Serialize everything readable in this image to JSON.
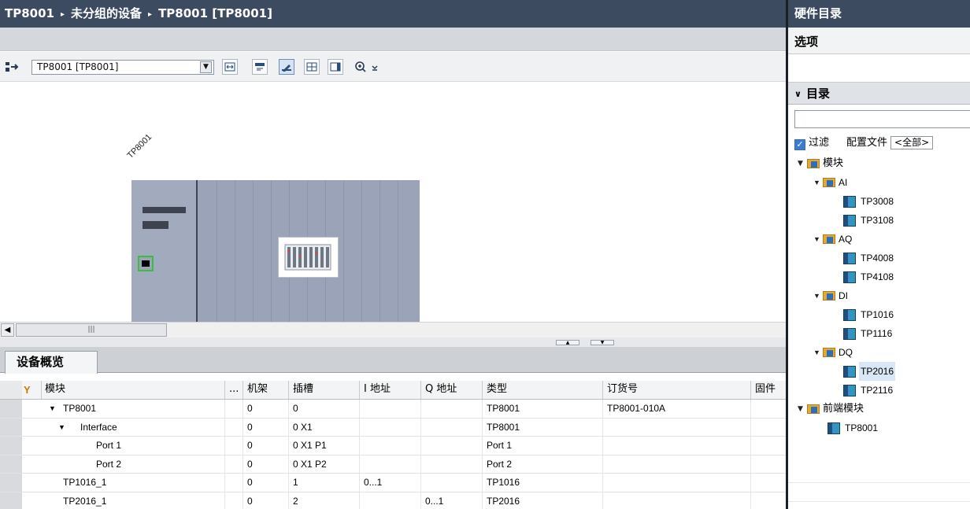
{
  "breadcrumb": {
    "items": [
      "TP8001",
      "未分组的设备",
      "TP8001 [TP8001]"
    ],
    "separator": "▸"
  },
  "toolbar": {
    "device_select_value": "TP8001 [TP8001]",
    "icons": [
      "device-network-icon",
      "dropdown-icon",
      "fit-view-icon",
      "show-names-icon",
      "draw-icon",
      "grid-icon",
      "panel-icon",
      "zoom-icon"
    ]
  },
  "canvas": {
    "device_label": "TP8001"
  },
  "tabs": {
    "overview": "设备概览"
  },
  "table": {
    "headers": {
      "module": "模块",
      "dots": "...",
      "rack": "机架",
      "slot": "插槽",
      "i_addr": "I 地址",
      "q_addr": "Q 地址",
      "type": "类型",
      "order": "订货号",
      "firmware": "固件"
    },
    "rows": [
      {
        "module": "TP8001",
        "toggle": "▼",
        "indent": 0,
        "rack": "0",
        "slot": "0",
        "i": "",
        "q": "",
        "type": "TP8001",
        "order": "TP8001-010A"
      },
      {
        "module": "Interface",
        "toggle": "▼",
        "indent": 1,
        "rack": "0",
        "slot": "0 X1",
        "i": "",
        "q": "",
        "type": "TP8001",
        "order": ""
      },
      {
        "module": "Port 1",
        "toggle": "",
        "indent": 2,
        "rack": "0",
        "slot": "0 X1 P1",
        "i": "",
        "q": "",
        "type": "Port 1",
        "order": ""
      },
      {
        "module": "Port 2",
        "toggle": "",
        "indent": 2,
        "rack": "0",
        "slot": "0 X1 P2",
        "i": "",
        "q": "",
        "type": "Port 2",
        "order": ""
      },
      {
        "module": "TP1016_1",
        "toggle": "",
        "indent": 0,
        "rack": "0",
        "slot": "1",
        "i": "0...1",
        "q": "",
        "type": "TP1016",
        "order": ""
      },
      {
        "module": "TP2016_1",
        "toggle": "",
        "indent": 0,
        "rack": "0",
        "slot": "2",
        "i": "",
        "q": "0...1",
        "type": "TP2016",
        "order": ""
      }
    ]
  },
  "catalog": {
    "title": "硬件目录",
    "options_label": "选项",
    "catalog_label": "目录",
    "filter_label": "过滤",
    "profile_label": "配置文件",
    "profile_value": "<全部>",
    "tree": [
      {
        "label": "模块",
        "kind": "folder",
        "level": 0,
        "cn": true
      },
      {
        "label": "AI",
        "kind": "folder",
        "level": 1
      },
      {
        "label": "TP3008",
        "kind": "module",
        "level": 2
      },
      {
        "label": "TP3108",
        "kind": "module",
        "level": 2
      },
      {
        "label": "AQ",
        "kind": "folder",
        "level": 1
      },
      {
        "label": "TP4008",
        "kind": "module",
        "level": 2
      },
      {
        "label": "TP4108",
        "kind": "module",
        "level": 2
      },
      {
        "label": "DI",
        "kind": "folder",
        "level": 1
      },
      {
        "label": "TP1016",
        "kind": "module",
        "level": 2
      },
      {
        "label": "TP1116",
        "kind": "module",
        "level": 2
      },
      {
        "label": "DQ",
        "kind": "folder",
        "level": 1
      },
      {
        "label": "TP2016",
        "kind": "module",
        "level": 2,
        "selected": true
      },
      {
        "label": "TP2116",
        "kind": "module",
        "level": 2
      },
      {
        "label": "前端模块",
        "kind": "folder",
        "level": 0,
        "cn": true
      },
      {
        "label": "TP8001",
        "kind": "module",
        "level": 1
      }
    ]
  },
  "colors": {
    "title_bar": "#3c4b5f",
    "rack": "#9aa3b7",
    "port_highlight": "#3cbd3c",
    "folder": "#e2a93a",
    "selected_row": "#d9e6f5"
  }
}
